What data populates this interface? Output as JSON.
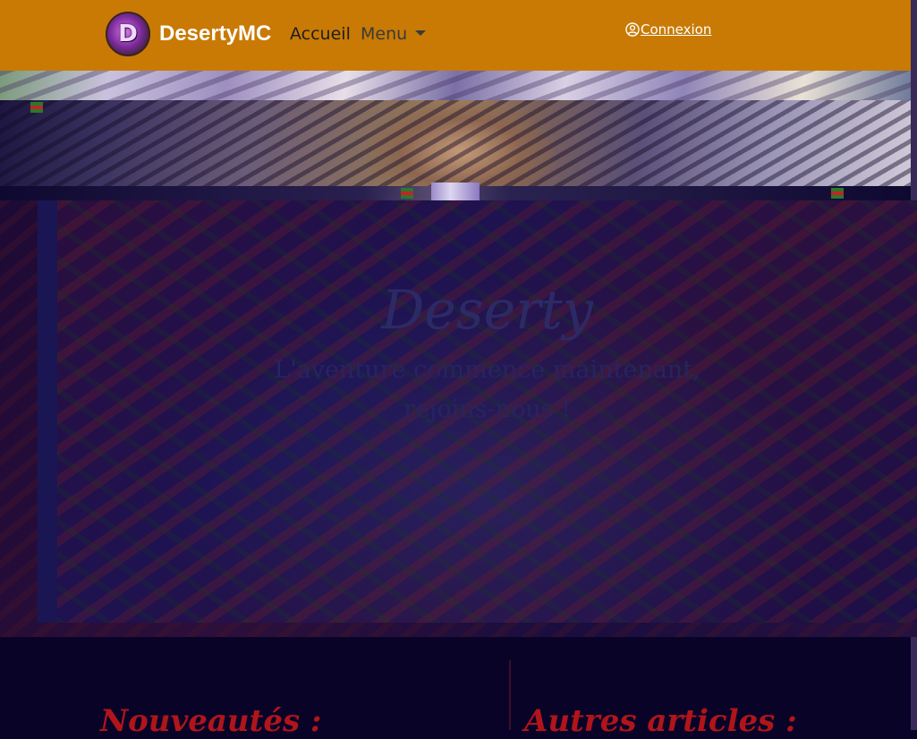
{
  "navbar": {
    "brand": "DesertyMC",
    "links": [
      "Accueil",
      "Menu"
    ],
    "login_label": "Connexion",
    "login_icon": "user-circle-icon",
    "logo_letter": "D",
    "bg_color": "#c97a05"
  },
  "hero": {
    "title": "Deserty",
    "subtitle_lines": [
      "L'aventure commence maintenant,",
      "rejoins-nous !"
    ]
  },
  "sections": {
    "news_title": "Nouveautés :",
    "other_title": "Autres articles :"
  }
}
